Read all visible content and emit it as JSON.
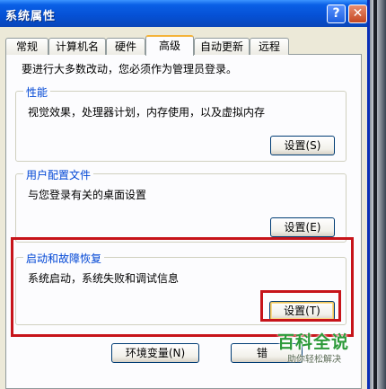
{
  "window": {
    "title": "系统属性",
    "help_symbol": "?",
    "close_symbol": "✕"
  },
  "tabs": [
    {
      "label": "常规"
    },
    {
      "label": "计算机名"
    },
    {
      "label": "硬件"
    },
    {
      "label": "高级",
      "active": true
    },
    {
      "label": "自动更新"
    },
    {
      "label": "远程"
    }
  ],
  "intro_text": "要进行大多数改动，您必须作为管理员登录。",
  "groups": {
    "performance": {
      "title": "性能",
      "description": "视觉效果，处理器计划，内存使用，以及虚拟内存",
      "button": "设置(S)"
    },
    "user_profiles": {
      "title": "用户配置文件",
      "description": "与您登录有关的桌面设置",
      "button": "设置(E)"
    },
    "startup_recovery": {
      "title": "启动和故障恢复",
      "description": "系统启动，系统失败和调试信息",
      "button": "设置(T)"
    }
  },
  "bottom_buttons": {
    "env_vars": "环境变量(N)",
    "error_report": "错"
  },
  "watermark": {
    "title": "百科全说",
    "subtitle": "助你轻松解决"
  },
  "colors": {
    "titlebar": "#0550d4",
    "highlight": "#c7141a",
    "group_title": "#0046d5"
  }
}
